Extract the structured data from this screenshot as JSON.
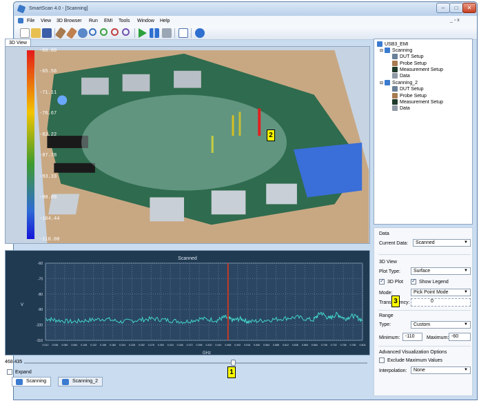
{
  "window": {
    "title": "SmartScan 4.0 - [Scanning]",
    "controls": {
      "minimize": "–",
      "maximize": "□",
      "close": "✕"
    }
  },
  "menu": {
    "items": [
      "File",
      "View",
      "3D Browser",
      "Run",
      "EMI",
      "Tools",
      "Window",
      "Help"
    ],
    "mdi_controls": "_ ▫ x"
  },
  "toolbar": {
    "icons": [
      "new-icon",
      "open-icon",
      "save-icon",
      "probe-icon",
      "probe-alt-icon",
      "view-rotate-icon",
      "zoom-icon",
      "zoom-in-icon",
      "zoom-out-icon",
      "zoom-fit-icon",
      "run-icon",
      "run-step-icon",
      "stop-icon",
      "report-icon",
      "help-icon"
    ]
  },
  "view3d": {
    "tab_label": "3D View",
    "legend": {
      "labels": [
        "-60.00",
        "-65.56",
        "-71.11",
        "-76.67",
        "-82.22",
        "-87.78",
        "-93.33",
        "-98.89",
        "-104.44",
        "-110.00"
      ]
    },
    "marker_2": "2"
  },
  "spectrum": {
    "title": "Scanned",
    "ylabel": "V",
    "xlabel": "GHz",
    "y_ticks": [
      "-60",
      "-70",
      "-80",
      "-90",
      "-100",
      "-110"
    ],
    "x_ticks": [
      "0.012",
      "0.036",
      "0.060",
      "0.084",
      "0.108",
      "0.132",
      "0.156",
      "0.180",
      "0.204",
      "0.228",
      "0.252",
      "0.276",
      "0.300",
      "0.324",
      "0.348",
      "0.372",
      "0.396",
      "0.420",
      "0.444",
      "0.468",
      "0.492",
      "0.516",
      "0.540",
      "0.564",
      "0.588",
      "0.612",
      "0.636",
      "0.660",
      "0.684",
      "0.708",
      "0.732",
      "0.756",
      "0.780",
      "0.804"
    ],
    "colors": {
      "trace": "#43d6c8",
      "cursor": "#c43a28",
      "background": "#203a52"
    }
  },
  "chart_data": {
    "type": "line",
    "title": "Scanned",
    "xlabel": "GHz",
    "ylabel": "V",
    "xlim": [
      0.012,
      0.804
    ],
    "ylim": [
      -110,
      -60
    ],
    "grid": true,
    "noise_floor": -97,
    "series": [
      {
        "x": [
          0.012,
          0.04,
          0.08,
          0.12,
          0.16,
          0.2,
          0.24,
          0.28,
          0.32,
          0.36,
          0.4,
          0.44,
          0.46,
          0.48,
          0.5,
          0.52,
          0.56,
          0.6,
          0.64,
          0.68,
          0.7,
          0.72,
          0.74,
          0.76,
          0.78,
          0.804
        ],
        "y": [
          -96,
          -97,
          -98,
          -97,
          -96,
          -98,
          -97,
          -96,
          -97,
          -98,
          -96,
          -97,
          -95,
          -97,
          -96,
          -98,
          -97,
          -96,
          -95,
          -97,
          -92,
          -96,
          -93,
          -96,
          -94,
          -97
        ]
      }
    ],
    "cursor_x": 0.468
  },
  "slider": {
    "value": "468.435",
    "marker_1": "1"
  },
  "expand": {
    "label": "Expand"
  },
  "bottom_tabs": [
    "Scanning",
    "Scanning_2"
  ],
  "tree": {
    "root": "USB3_EMI",
    "groups": [
      {
        "name": "Scanning",
        "children": [
          "DUT Setup",
          "Probe Setup",
          "Measurement Setup",
          "Data"
        ]
      },
      {
        "name": "Scanning_2",
        "children": [
          "DUT Setup",
          "Probe Setup",
          "Measurement Setup",
          "Data"
        ]
      }
    ]
  },
  "properties": {
    "data_section": "Data",
    "current_data_label": "Current Data:",
    "current_data_value": "Scanned",
    "view3d_section": "3D View",
    "plot_type_label": "Plot Type:",
    "plot_type_value": "Surface",
    "plot3d_label": "3D Plot",
    "show_legend_label": "Show Legend",
    "mode_label": "Mode:",
    "mode_value": "Pick Point Mode",
    "transparency_label": "Transparency:",
    "transparency_value": "0",
    "marker_3": "3",
    "range_section": "Range",
    "type_label": "Type:",
    "type_value": "Custom",
    "minimum_label": "Minimum:",
    "minimum_value": "-110",
    "maximum_label": "Maximum:",
    "maximum_value": "-60",
    "adv_section": "Advanced Visualization Options",
    "exclude_label": "Exclude Maximum Values",
    "interpolation_label": "Interpolation:",
    "interpolation_value": "None"
  }
}
